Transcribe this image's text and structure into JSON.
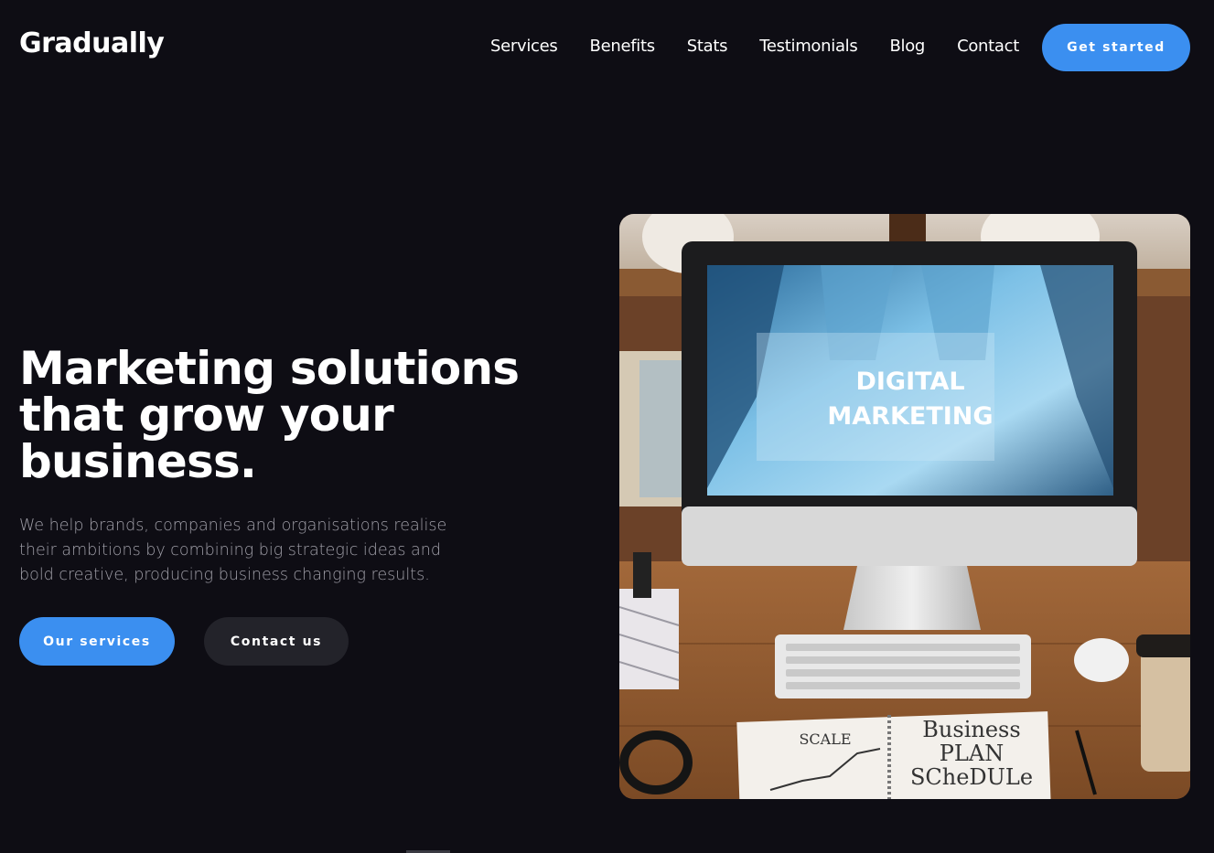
{
  "brand": {
    "name": "Gradually"
  },
  "nav": {
    "items": [
      {
        "label": "Services"
      },
      {
        "label": "Benefits"
      },
      {
        "label": "Stats"
      },
      {
        "label": "Testimonials"
      },
      {
        "label": "Blog"
      },
      {
        "label": "Contact"
      }
    ],
    "cta_label": "Get started"
  },
  "hero": {
    "title_lines": [
      "Marketing solutions",
      "that grow your",
      "business."
    ],
    "description": "We help brands, companies and organisations realise their ambitions by combining big strategic ideas and bold creative, producing business changing results.",
    "primary_button": "Our services",
    "secondary_button": "Contact us"
  },
  "image": {
    "screen_text_line1": "DIGITAL",
    "screen_text_line2": "MARKETING",
    "notebook_left_text": "SCALE",
    "notebook_right_line1": "Business",
    "notebook_right_line2": "PLAN",
    "notebook_right_line3": "SCheDULe"
  },
  "colors": {
    "background": "#0e0d14",
    "accent": "#3b8ff0",
    "secondary_button": "#23232a",
    "muted_text": "#a09fa8"
  }
}
